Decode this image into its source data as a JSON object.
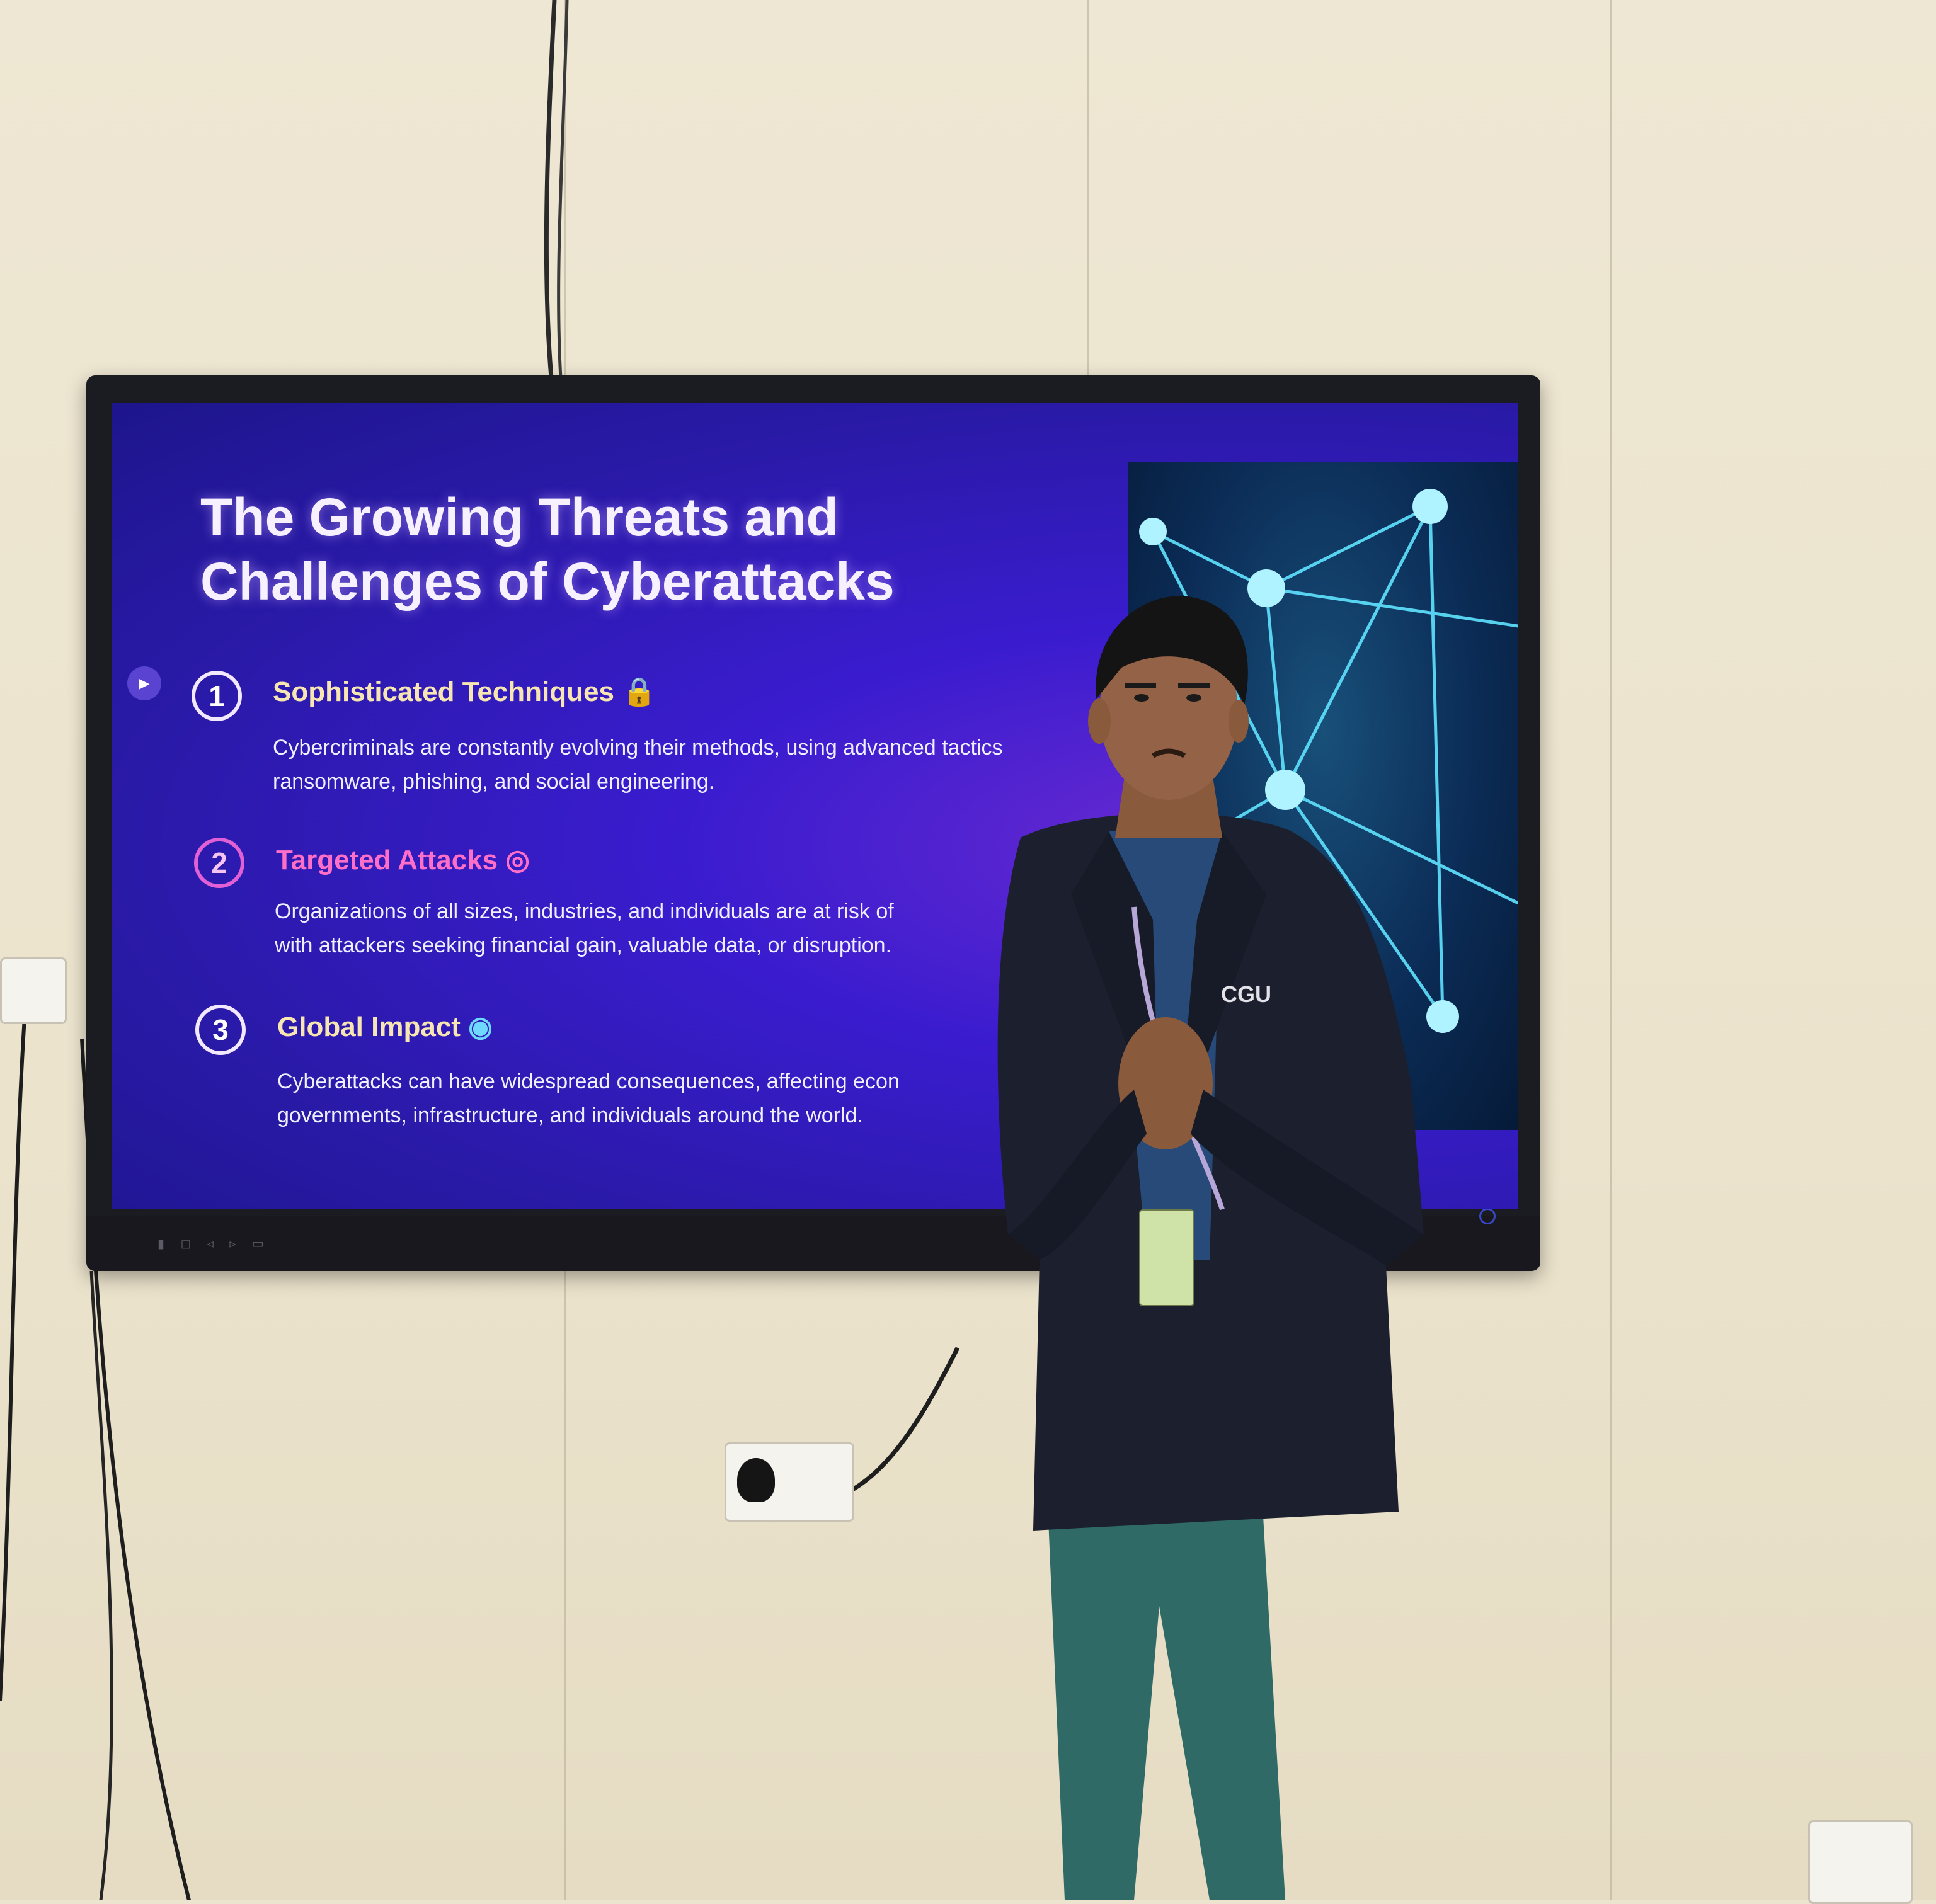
{
  "slide": {
    "title_line1": "The Growing Threats and",
    "title_line2": "Challenges of Cyberattacks",
    "items": [
      {
        "number": "1",
        "heading": "Sophisticated Techniques",
        "heading_icon": "lock-icon",
        "text_line1": "Cybercriminals are constantly evolving their methods, using advanced tactics",
        "text_line2": "ransomware, phishing, and social engineering."
      },
      {
        "number": "2",
        "heading": "Targeted Attacks",
        "heading_icon": "target-icon",
        "text_line1": "Organizations of all sizes, industries, and individuals are at risk of",
        "text_line2": "with attackers seeking financial gain, valuable data, or disruption."
      },
      {
        "number": "3",
        "heading": "Global Impact",
        "heading_icon": "globe-icon",
        "text_line1": "Cyberattacks can have widespread consequences, affecting econ",
        "text_line2": "governments, infrastructure, and individuals around the world."
      }
    ]
  },
  "colors": {
    "slide_bg": "#2a1aa8",
    "title": "#f6f0ff",
    "heading_gold": "#f8e6b2",
    "heading_pink": "#ff6fc8",
    "network_cyan": "#5fe3ff",
    "wall": "#ece4cf",
    "blazer": "#1c1f2e",
    "trousers": "#2f6a66"
  }
}
